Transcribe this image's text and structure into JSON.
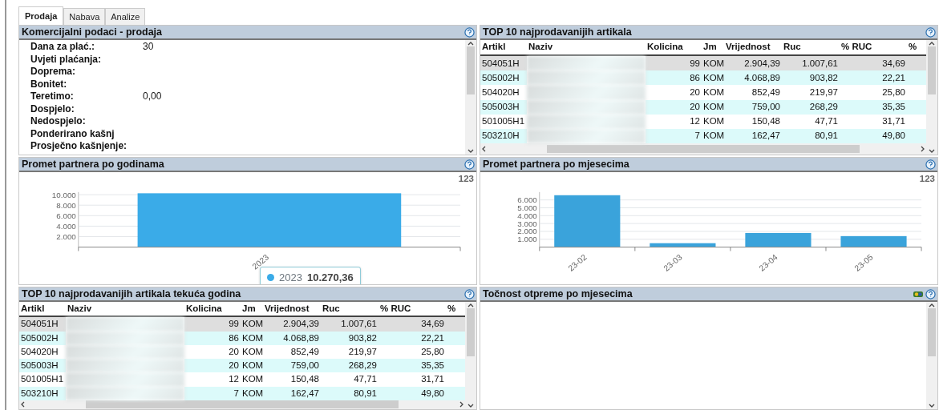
{
  "tabs": [
    {
      "label": "Prodaja",
      "selected": true
    },
    {
      "label": "Nabava",
      "selected": false
    },
    {
      "label": "Analize",
      "selected": false
    }
  ],
  "commercial_panel": {
    "title": "Komercijalni podaci - prodaja",
    "fields": [
      {
        "label": "Dana za plać.:",
        "value": "30"
      },
      {
        "label": "Uvjeti plaćanja:"
      },
      {
        "label": "Doprema:"
      },
      {
        "label": "Bonitet:"
      },
      {
        "label": "Teretimo:",
        "value": "0,00"
      },
      {
        "label": "Dospjelo:"
      },
      {
        "label": "Nedospjelo:"
      },
      {
        "label": "Ponderirano kašnj"
      },
      {
        "label": "Prosječno kašnjenje:"
      }
    ]
  },
  "top10_panel": {
    "title": "TOP 10 najprodavanijih artikala",
    "columns": [
      "Artikl",
      "Naziv",
      "Kolicina",
      "Jm",
      "Vrijednost",
      "Ruc",
      "% RUC",
      "%"
    ],
    "rows": [
      {
        "artikl": "504051H",
        "kolicina": "99",
        "jm": "KOM",
        "vrijednost": "2.904,39",
        "ruc": "1.007,61",
        "ruc_pct": "34,69",
        "selected": true
      },
      {
        "artikl": "505002H",
        "kolicina": "86",
        "jm": "KOM",
        "vrijednost": "4.068,89",
        "ruc": "903,82",
        "ruc_pct": "22,21",
        "selected": false
      },
      {
        "artikl": "504020H",
        "kolicina": "20",
        "jm": "KOM",
        "vrijednost": "852,49",
        "ruc": "219,97",
        "ruc_pct": "25,80",
        "selected": false
      },
      {
        "artikl": "505003H",
        "kolicina": "20",
        "jm": "KOM",
        "vrijednost": "759,00",
        "ruc": "268,29",
        "ruc_pct": "35,35",
        "selected": false
      },
      {
        "artikl": "501005H1",
        "kolicina": "12",
        "jm": "KOM",
        "vrijednost": "150,48",
        "ruc": "47,71",
        "ruc_pct": "31,71",
        "selected": false
      },
      {
        "artikl": "503210H",
        "kolicina": "7",
        "jm": "KOM",
        "vrijednost": "162,47",
        "ruc": "80,91",
        "ruc_pct": "49,80",
        "selected": false
      }
    ]
  },
  "yearly_panel": {
    "title": "Promet partnera po godinama",
    "button": "123",
    "tooltip": {
      "label": "2023",
      "value": "10.270,36"
    },
    "chart_data": {
      "type": "bar",
      "categories": [
        "2023"
      ],
      "grid": true,
      "series": [
        {
          "color": "#3aabe8",
          "values": [
            10270
          ]
        }
      ],
      "ylim": [
        0,
        10500
      ],
      "yticks": [
        {
          "value": 2000,
          "label": "2.000"
        },
        {
          "value": 4000,
          "label": "4.000"
        },
        {
          "value": 6000,
          "label": "6.000"
        },
        {
          "value": 8000,
          "label": "8.000"
        },
        {
          "value": 10000,
          "label": "10.000"
        }
      ]
    }
  },
  "monthly_panel": {
    "title": "Promet partnera po mjesecima",
    "button": "123",
    "chart_data": {
      "type": "bar",
      "categories": [
        "23-02",
        "23-03",
        "23-04",
        "23-05"
      ],
      "grid": true,
      "series": [
        {
          "color": "#3aa3db",
          "values": [
            6600,
            500,
            1800,
            1400
          ]
        }
      ],
      "ylim": [
        0,
        7000
      ],
      "yticks": [
        {
          "value": 1000,
          "label": "1.000"
        },
        {
          "value": 2000,
          "label": "2.000"
        },
        {
          "value": 3000,
          "label": "3.000"
        },
        {
          "value": 4000,
          "label": "4.000"
        },
        {
          "value": 5000,
          "label": "5.000"
        },
        {
          "value": 6000,
          "label": "6.000"
        }
      ]
    }
  },
  "top10_year_panel": {
    "title": "TOP 10 najprodavanijih artikala tekuća godina",
    "columns": [
      "Artikl",
      "Naziv",
      "Kolicina",
      "Jm",
      "Vrijednost",
      "Ruc",
      "% RUC",
      "%"
    ],
    "rows": [
      {
        "artikl": "504051H",
        "kolicina": "99",
        "jm": "KOM",
        "vrijednost": "2.904,39",
        "ruc": "1.007,61",
        "ruc_pct": "34,69",
        "selected": true
      },
      {
        "artikl": "505002H",
        "kolicina": "86",
        "jm": "KOM",
        "vrijednost": "4.068,89",
        "ruc": "903,82",
        "ruc_pct": "22,21",
        "selected": false
      },
      {
        "artikl": "504020H",
        "kolicina": "20",
        "jm": "KOM",
        "vrijednost": "852,49",
        "ruc": "219,97",
        "ruc_pct": "25,80",
        "selected": false
      },
      {
        "artikl": "505003H",
        "kolicina": "20",
        "jm": "KOM",
        "vrijednost": "759,00",
        "ruc": "268,29",
        "ruc_pct": "35,35",
        "selected": false
      },
      {
        "artikl": "501005H1",
        "kolicina": "12",
        "jm": "KOM",
        "vrijednost": "150,48",
        "ruc": "47,71",
        "ruc_pct": "31,71",
        "selected": false
      },
      {
        "artikl": "503210H",
        "kolicina": "7",
        "jm": "KOM",
        "vrijednost": "162,47",
        "ruc": "80,91",
        "ruc_pct": "49,80",
        "selected": false
      }
    ]
  },
  "accuracy_panel": {
    "title": "Točnost otpreme po mjesecima"
  }
}
